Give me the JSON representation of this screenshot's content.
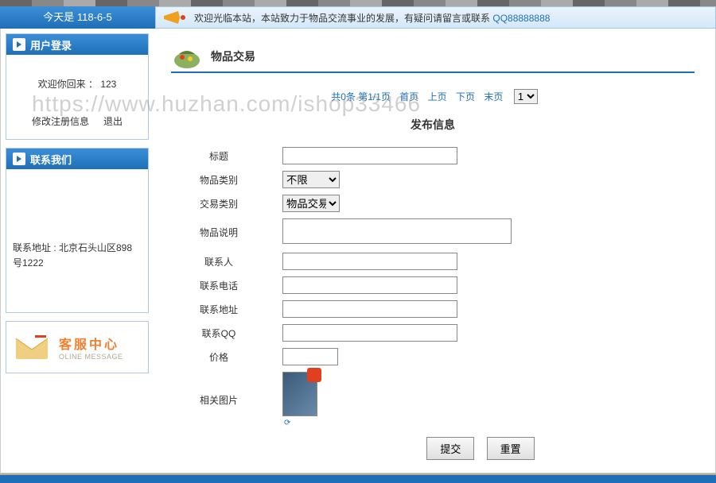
{
  "watermark": "https://www.huzhan.com/ishop33466",
  "date_bar": {
    "text": "今天是 118-6-5"
  },
  "announce": {
    "text": "欢迎光临本站，本站致力于物品交流事业的发展，有疑问请留言或联系",
    "qq": "QQ88888888"
  },
  "sidebar": {
    "login": {
      "header": "用户登录",
      "welcome_prefix": "欢迎你回来 ：",
      "username": "123",
      "edit_info": "修改注册信息",
      "logout": "退出"
    },
    "contact": {
      "header": "联系我们",
      "address": "联系地址 : 北京石头山区898号1222"
    },
    "service": {
      "title": "客服中心",
      "subtitle": "OLINE MESSAGE"
    }
  },
  "content": {
    "section_title": "物品交易",
    "pagination": {
      "info": "共0条 第1/1页",
      "first": "首页",
      "prev": "上页",
      "next": "下页",
      "last": "末页",
      "select_value": "1"
    },
    "publish_title": "发布信息",
    "form": {
      "labels": {
        "title": "标题",
        "item_type": "物品类别",
        "trans_type": "交易类别",
        "desc": "物品说明",
        "contact_name": "联系人",
        "contact_phone": "联系电话",
        "contact_addr": "联系地址",
        "contact_qq": "联系QQ",
        "price": "价格",
        "image": "相关图片"
      },
      "item_type_value": "不限",
      "trans_type_value": "物品交易",
      "thumb_link": "⟳"
    },
    "buttons": {
      "submit": "提交",
      "reset": "重置"
    }
  }
}
